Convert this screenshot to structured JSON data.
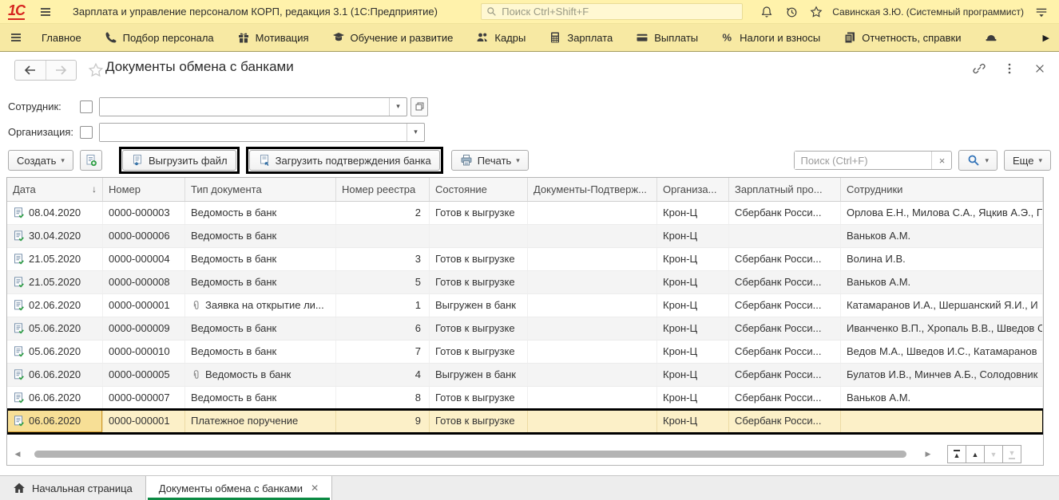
{
  "titlebar": {
    "logo": "1С",
    "app_title": "Зарплата и управление персоналом КОРП, редакция 3.1  (1С:Предприятие)",
    "search_placeholder": "Поиск Ctrl+Shift+F",
    "user": "Савинская З.Ю. (Системный программист)"
  },
  "menubar": {
    "items": [
      {
        "label": "Главное",
        "icon": ""
      },
      {
        "label": "Подбор персонала",
        "icon": "phone-icon"
      },
      {
        "label": "Мотивация",
        "icon": "gift-icon"
      },
      {
        "label": "Обучение и развитие",
        "icon": "education-icon"
      },
      {
        "label": "Кадры",
        "icon": "people-icon"
      },
      {
        "label": "Зарплата",
        "icon": "calculator-icon"
      },
      {
        "label": "Выплаты",
        "icon": "card-icon"
      },
      {
        "label": "Налоги и взносы",
        "icon": "percent-icon"
      },
      {
        "label": "Отчетность, справки",
        "icon": "report-icon"
      },
      {
        "label": "",
        "icon": "helmet-icon"
      }
    ]
  },
  "page": {
    "title": "Документы обмена с банками"
  },
  "filters": {
    "employee_label": "Сотрудник:",
    "organization_label": "Организация:",
    "employee_value": "",
    "organization_value": ""
  },
  "toolbar": {
    "create_label": "Создать",
    "export_label": "Выгрузить файл",
    "import_label": "Загрузить подтверждения банка",
    "print_label": "Печать",
    "search_placeholder": "Поиск (Ctrl+F)",
    "more_label": "Еще"
  },
  "table": {
    "columns": [
      {
        "label": "Дата",
        "sorted": "desc"
      },
      {
        "label": "Номер"
      },
      {
        "label": "Тип документа"
      },
      {
        "label": "Номер реестра"
      },
      {
        "label": "Состояние"
      },
      {
        "label": "Документы-Подтверж..."
      },
      {
        "label": "Организа..."
      },
      {
        "label": "Зарплатный про..."
      },
      {
        "label": "Сотрудники"
      }
    ],
    "rows": [
      {
        "date": "08.04.2020",
        "number": "0000-000003",
        "attachment": false,
        "type": "Ведомость в банк",
        "registry": "2",
        "state": "Готов к выгрузке",
        "confirm": "",
        "org": "Крон-Ц",
        "project": "Сбербанк Росси...",
        "employees": "Орлова Е.Н., Милова С.А., Яцкив А.Э., П",
        "selected": false
      },
      {
        "date": "30.04.2020",
        "number": "0000-000006",
        "attachment": false,
        "type": "Ведомость в банк",
        "registry": "",
        "state": "",
        "confirm": "",
        "org": "Крон-Ц",
        "project": "",
        "employees": "Ваньков А.М.",
        "selected": false
      },
      {
        "date": "21.05.2020",
        "number": "0000-000004",
        "attachment": false,
        "type": "Ведомость в банк",
        "registry": "3",
        "state": "Готов к выгрузке",
        "confirm": "",
        "org": "Крон-Ц",
        "project": "Сбербанк Росси...",
        "employees": "Волина И.В.",
        "selected": false
      },
      {
        "date": "21.05.2020",
        "number": "0000-000008",
        "attachment": false,
        "type": "Ведомость в банк",
        "registry": "5",
        "state": "Готов к выгрузке",
        "confirm": "",
        "org": "Крон-Ц",
        "project": "Сбербанк Росси...",
        "employees": "Ваньков А.М.",
        "selected": false
      },
      {
        "date": "02.06.2020",
        "number": "0000-000001",
        "attachment": true,
        "type": "Заявка на открытие ли...",
        "registry": "1",
        "state": "Выгружен в банк",
        "confirm": "",
        "org": "Крон-Ц",
        "project": "Сбербанк Росси...",
        "employees": "Катамаранов И.А., Шершанский Я.И., И",
        "selected": false
      },
      {
        "date": "05.06.2020",
        "number": "0000-000009",
        "attachment": false,
        "type": "Ведомость в банк",
        "registry": "6",
        "state": "Готов к выгрузке",
        "confirm": "",
        "org": "Крон-Ц",
        "project": "Сбербанк Росси...",
        "employees": "Иванченко В.П., Хропаль В.В., Шведов С",
        "selected": false
      },
      {
        "date": "05.06.2020",
        "number": "0000-000010",
        "attachment": false,
        "type": "Ведомость в банк",
        "registry": "7",
        "state": "Готов к выгрузке",
        "confirm": "",
        "org": "Крон-Ц",
        "project": "Сбербанк Росси...",
        "employees": "Ведов М.А., Шведов И.С., Катамаранов",
        "selected": false
      },
      {
        "date": "06.06.2020",
        "number": "0000-000005",
        "attachment": true,
        "type": "Ведомость в банк",
        "registry": "4",
        "state": "Выгружен в банк",
        "confirm": "",
        "org": "Крон-Ц",
        "project": "Сбербанк Росси...",
        "employees": "Булатов И.В., Минчев А.Б., Солодовник",
        "selected": false
      },
      {
        "date": "06.06.2020",
        "number": "0000-000007",
        "attachment": false,
        "type": "Ведомость в банк",
        "registry": "8",
        "state": "Готов к выгрузке",
        "confirm": "",
        "org": "Крон-Ц",
        "project": "Сбербанк Росси...",
        "employees": "Ваньков А.М.",
        "selected": false
      },
      {
        "date": "06.06.2020",
        "number": "0000-000001",
        "attachment": false,
        "type": "Платежное поручение",
        "registry": "9",
        "state": "Готов к выгрузке",
        "confirm": "",
        "org": "Крон-Ц",
        "project": "Сбербанк Росси...",
        "employees": "",
        "selected": true
      }
    ]
  },
  "scrollnav": [
    {
      "icon": "scroll-top-icon",
      "enabled": true
    },
    {
      "icon": "scroll-up-icon",
      "enabled": true
    },
    {
      "icon": "scroll-down-icon",
      "enabled": false
    },
    {
      "icon": "scroll-bottom-icon",
      "enabled": false
    }
  ],
  "tabs": {
    "home_label": "Начальная страница",
    "active_label": "Документы обмена с банками"
  },
  "colors": {
    "titlebar_bg": "#fff2ab",
    "menubar_bg": "#f7e9a3",
    "selected_row_bg": "#fcf0c8",
    "focused_cell_bg": "#f7df96",
    "active_tab_underline": "#0c8a43",
    "annotation_border": "#000000",
    "logo_red": "#d6231f",
    "accent_blue": "#3273b8"
  }
}
